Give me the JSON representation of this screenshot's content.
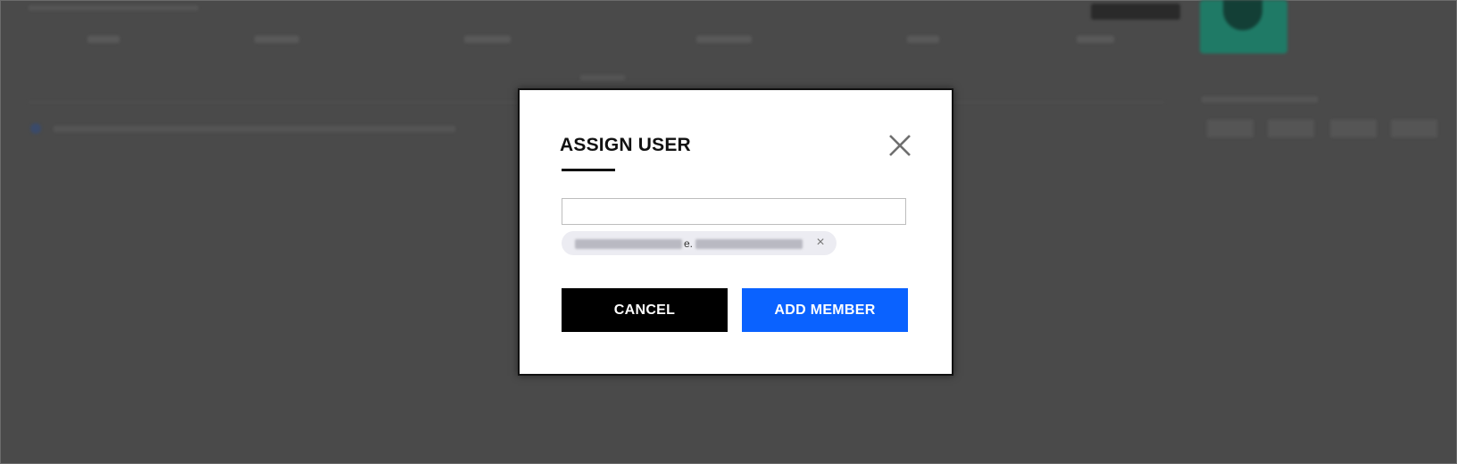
{
  "modal": {
    "title": "ASSIGN USER",
    "close_icon": "close-icon",
    "search": {
      "value": "",
      "placeholder": ""
    },
    "selected_user": {
      "visible_text": "e.",
      "remove_icon": "×"
    },
    "buttons": {
      "cancel_label": "CANCEL",
      "add_label": "ADD MEMBER"
    }
  },
  "colors": {
    "overlay": "#4a4a4a",
    "add_button": "#0a62ff",
    "cancel_button": "#000000",
    "chip_background": "#ececf2",
    "background_accent": "#1f7a66"
  }
}
